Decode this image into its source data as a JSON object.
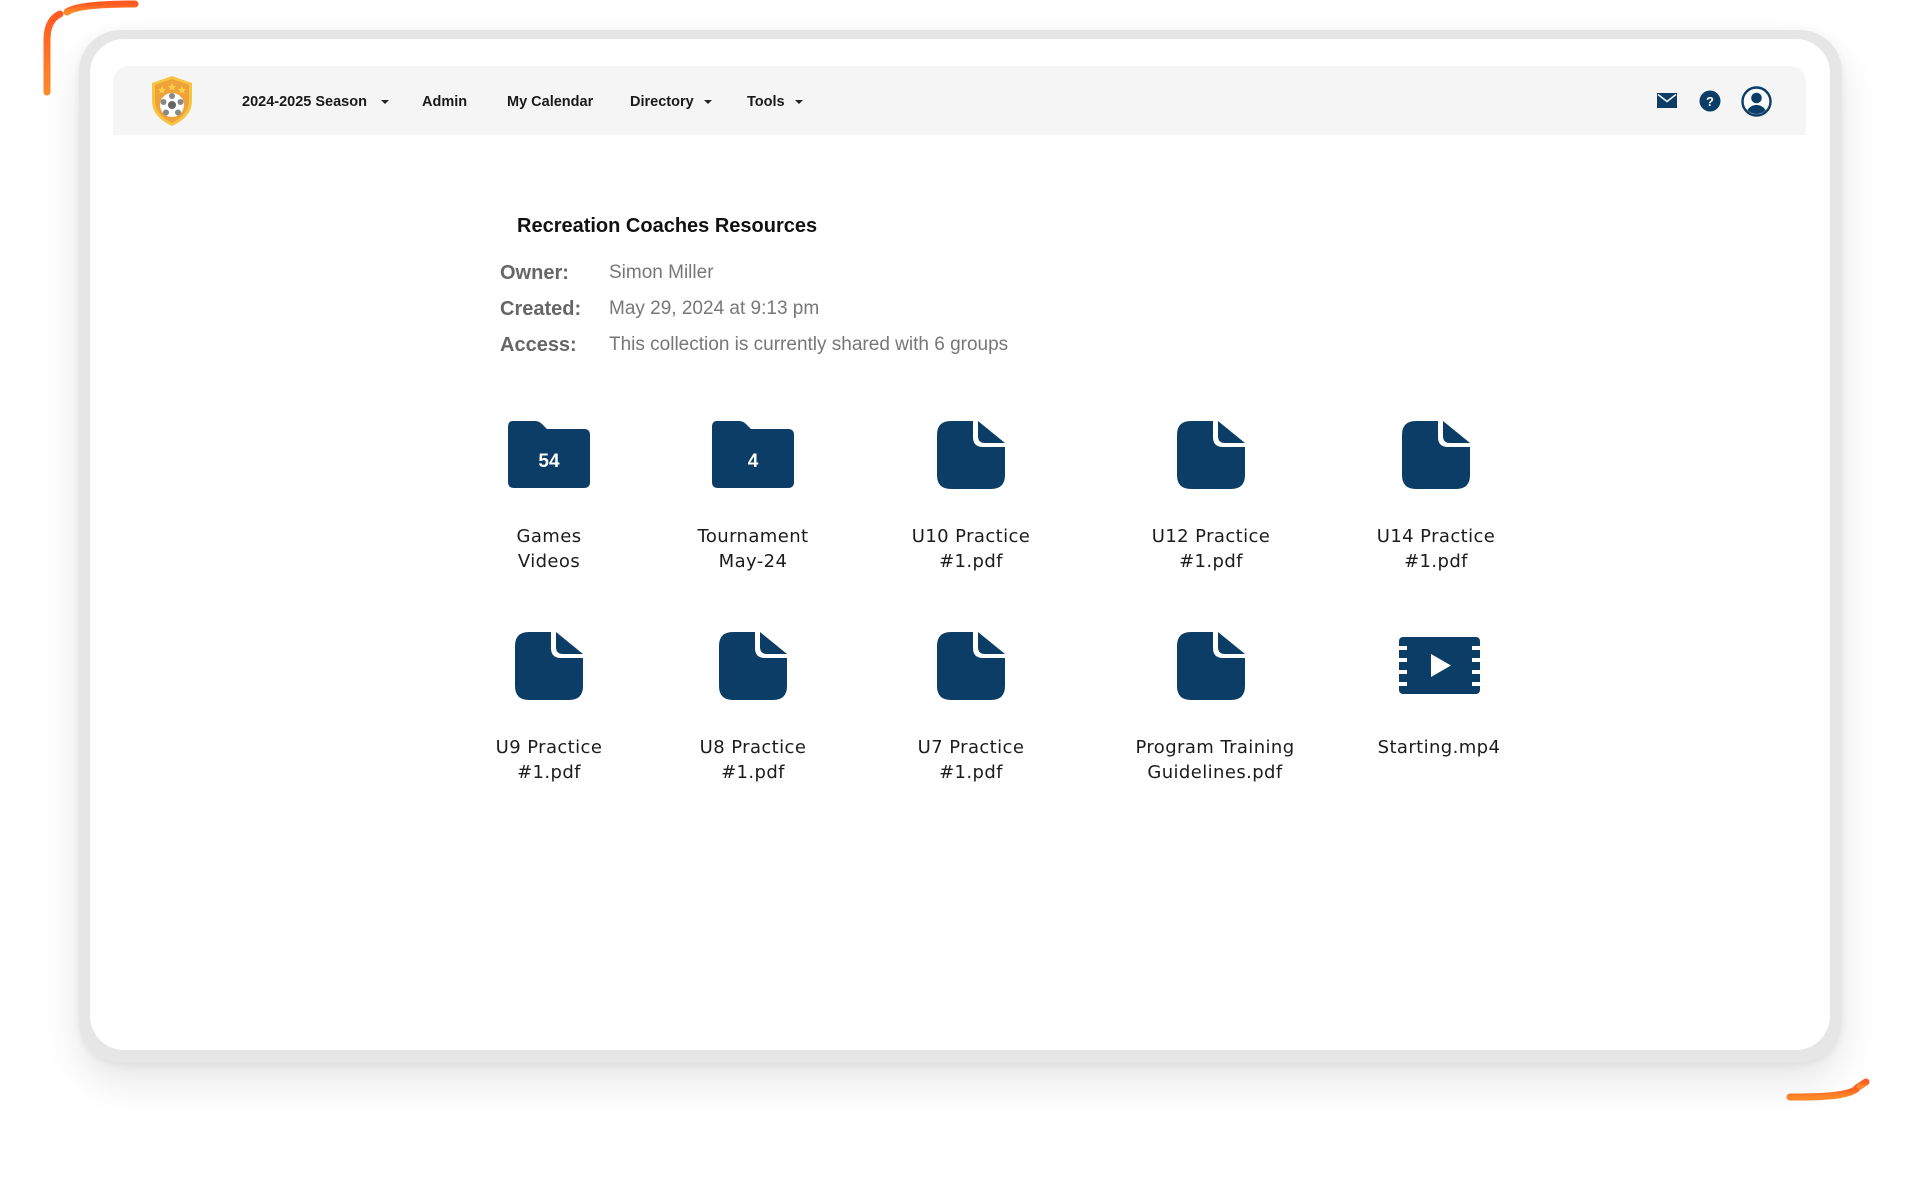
{
  "colors": {
    "accent": "#0b3d66",
    "logo_orange": "#f0a23a",
    "logo_gold": "#f6c343",
    "decor_orange": "#ff6b2b",
    "nav_bg": "#f5f5f5"
  },
  "navbar": {
    "logo": "soccer-shield-logo",
    "items": [
      {
        "label": "2024-2025 Season",
        "dropdown": true
      },
      {
        "label": "Admin",
        "dropdown": false
      },
      {
        "label": "My Calendar",
        "dropdown": false
      },
      {
        "label": "Directory",
        "dropdown": true
      },
      {
        "label": "Tools",
        "dropdown": true
      }
    ],
    "icons": [
      "mail-icon",
      "help-icon",
      "user-account-icon"
    ]
  },
  "collection": {
    "title": "Recreation Coaches Resources",
    "meta": [
      {
        "label": "Owner:",
        "value": "Simon Miller"
      },
      {
        "label": "Created:",
        "value": "May 29, 2024 at 9:13 pm"
      },
      {
        "label": "Access:",
        "value": "This collection is currently shared with 6 groups"
      }
    ],
    "items": [
      {
        "type": "folder",
        "count": "54",
        "line1": "Games",
        "line2": "Videos"
      },
      {
        "type": "folder",
        "count": "4",
        "line1": "Tournament",
        "line2": "May-24"
      },
      {
        "type": "document",
        "line1": "U10 Practice",
        "line2": "#1.pdf"
      },
      {
        "type": "document",
        "line1": "U12 Practice",
        "line2": "#1.pdf"
      },
      {
        "type": "document",
        "line1": "U14 Practice",
        "line2": "#1.pdf"
      },
      {
        "type": "document",
        "line1": "U9 Practice",
        "line2": "#1.pdf"
      },
      {
        "type": "document",
        "line1": "U8 Practice",
        "line2": "#1.pdf"
      },
      {
        "type": "document",
        "line1": "U7 Practice",
        "line2": "#1.pdf"
      },
      {
        "type": "document",
        "line1": "Program Training",
        "line2": "Guidelines.pdf"
      },
      {
        "type": "video",
        "line1": "Starting.mp4",
        "line2": ""
      }
    ]
  }
}
